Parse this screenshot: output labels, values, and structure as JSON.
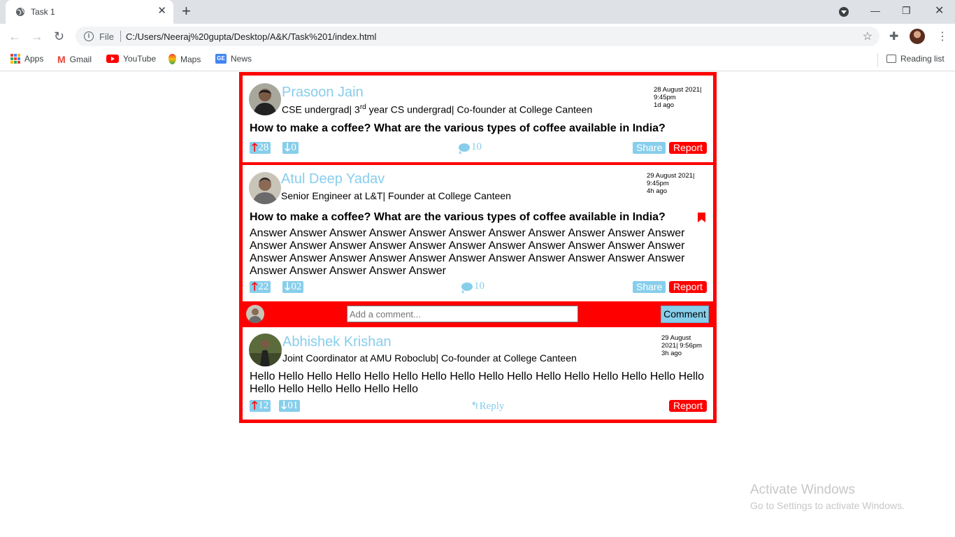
{
  "browser": {
    "tab_title": "Task 1",
    "new_tab": "+",
    "omnibox_scheme": "File",
    "url": "C:/Users/Neeraj%20gupta/Desktop/A&K/Task%201/index.html",
    "bookmarks": [
      "Apps",
      "Gmail",
      "YouTube",
      "Maps",
      "News"
    ],
    "reading_list": "Reading list"
  },
  "posts": [
    {
      "name": "Prasoon Jain",
      "tagline_pre": "CSE undergrad| 3",
      "tagline_sup": "rd",
      "tagline_post": " year CS undergrad| Co-founder at College Canteen",
      "ts_line1": "28 August 2021|",
      "ts_line2": "9:45pm",
      "ts_line3": "1d ago",
      "question": "How to make a coffee? What are the various types of coffee available in India?",
      "upvotes": "28",
      "downvotes": "0",
      "comments": "10",
      "share": "Share",
      "report": "Report"
    },
    {
      "name": "Atul Deep Yadav",
      "tagline": "Senior Engineer at L&T| Founder at College Canteen",
      "ts_line1": "29 August 2021|",
      "ts_line2": "9:45pm",
      "ts_line3": "4h ago",
      "question": "How to make a coffee? What are the various types of coffee available in India?",
      "answer": "Answer Answer Answer Answer Answer Answer Answer Answer Answer Answer Answer Answer Answer Answer Answer Answer Answer Answer Answer Answer Answer Answer Answer Answer Answer Answer Answer Answer Answer Answer Answer Answer Answer Answer Answer Answer Answer Answer",
      "upvotes": "22",
      "downvotes": "02",
      "comments": "10",
      "share": "Share",
      "report": "Report"
    }
  ],
  "comment_box": {
    "placeholder": "Add a comment...",
    "button": "Comment"
  },
  "reply": {
    "name": "Abhishek Krishan",
    "tagline": "Joint Coordinator at AMU Roboclub| Co-founder at College Canteen",
    "ts_line1": "29 August",
    "ts_line2": "2021| 9:56pm",
    "ts_line3": "3h ago",
    "text": "Hello Hello Hello Hello Hello Hello Hello Hello Hello Hello Hello Hello Hello Hello Hello Hello Hello Hello Hello Hello Hello Hello",
    "upvotes": "12",
    "downvotes": "01",
    "reply_label": "Reply",
    "report": "Report"
  },
  "watermark": {
    "title": "Activate Windows",
    "subtitle": "Go to Settings to activate Windows."
  },
  "colors": {
    "accent_red": "#ff0000",
    "accent_blue": "#87ceeb"
  }
}
